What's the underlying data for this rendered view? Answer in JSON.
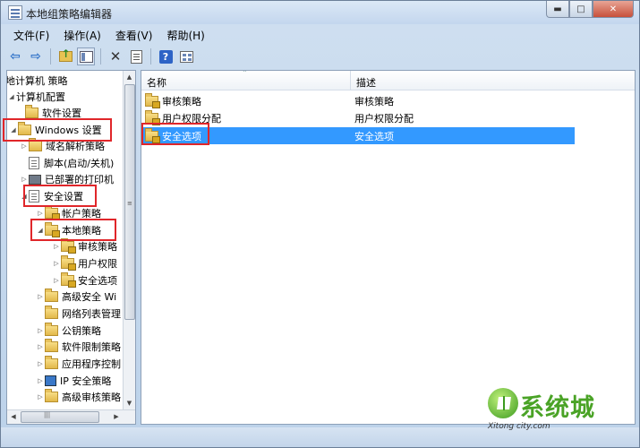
{
  "window": {
    "title": "本地组策略编辑器",
    "min_glyph": "▬",
    "max_glyph": "□",
    "close_glyph": "✕"
  },
  "menu": [
    "文件(F)",
    "操作(A)",
    "查看(V)",
    "帮助(H)"
  ],
  "toolbar": {
    "back_glyph": "⇦",
    "forward_glyph": "⇨",
    "help_glyph": "?"
  },
  "tree": {
    "root": "地计算机 策略",
    "computer_config": "计算机配置",
    "software_settings": "软件设置",
    "windows_settings": "Windows 设置",
    "name_resolution": "域名解析策略",
    "scripts": "脚本(启动/关机)",
    "printers": "已部署的打印机",
    "security_settings": "安全设置",
    "account_policies": "帐户策略",
    "local_policies": "本地策略",
    "audit_policy": "审核策略",
    "user_rights": "用户权限",
    "security_options": "安全选项",
    "advanced_firewall": "高级安全 Wi",
    "network_list": "网络列表管理",
    "public_key": "公钥策略",
    "software_restriction": "软件限制策略",
    "app_control": "应用程序控制",
    "ip_security": "IP 安全策略",
    "advanced_audit": "高级审核策略"
  },
  "list": {
    "columns": [
      "名称",
      "描述"
    ],
    "rows": [
      {
        "name": "审核策略",
        "desc": "审核策略",
        "selected": false
      },
      {
        "name": "用户权限分配",
        "desc": "用户权限分配",
        "selected": false
      },
      {
        "name": "安全选项",
        "desc": "安全选项",
        "selected": true
      }
    ]
  },
  "watermark": {
    "brand": "系统城",
    "url": "Xitong city.com"
  },
  "colors": {
    "selection": "#3399ff",
    "highlight_box": "#e0262a"
  }
}
